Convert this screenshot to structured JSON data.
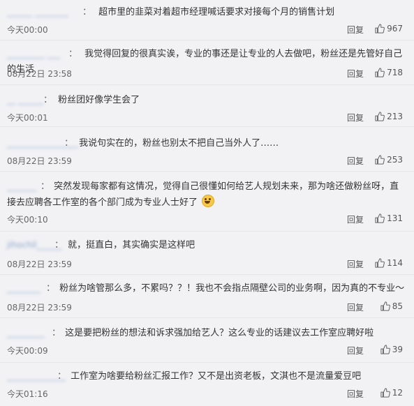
{
  "reply_label": "回复",
  "comments": [
    {
      "user": "______ ________",
      "text": "超市里的韭菜对着超市经理喊话要求对接每个月的销售计划",
      "time": "今天00:00",
      "likes": "967"
    },
    {
      "user": "_________ ___",
      "text": "我觉得回复的很真实诶，专业的事还是让专业的人去做吧，粉丝还是先管好自己的生活",
      "time": "08月22日 23:58",
      "likes": "718"
    },
    {
      "user": "__ ______",
      "text": "粉丝团好像学生会了",
      "time": "今天00:01",
      "likes": "213"
    },
    {
      "user": "_________________",
      "text": "我说句实在的，粉丝也别太不把自己当外人了……",
      "time": "08月22日 23:59",
      "likes": "253"
    },
    {
      "user": "_______",
      "text": "突然发现每家都有这情况，觉得自己很懂如何给艺人规划未来，那为啥还做粉丝呀，直接去应聘各工作室的各个部门成为专业人士好了",
      "time": "今天00:10",
      "likes": "131"
    },
    {
      "user": "jihochil______",
      "text": "就，挺直白，其实确实是这样吧",
      "time": "08月22日 23:59",
      "likes": "114"
    },
    {
      "user": "________",
      "text": "粉丝为啥管那么多，不累吗？？！我也不会指点隔壁公司的业务啊，因为真的不专业～",
      "time": "08月22日 23:59",
      "likes": "85"
    },
    {
      "user": "_________",
      "text": "这是要把粉丝的想法和诉求强加给艺人？这么专业的话建议去工作室应聘好啦",
      "time": "今天00:09",
      "likes": "39"
    },
    {
      "user": "______________",
      "text": "工作室为啥要给粉丝汇报工作？又不是出资老板，文淇也不是流量爱豆吧",
      "time": "今天01:16",
      "likes": "12"
    }
  ]
}
